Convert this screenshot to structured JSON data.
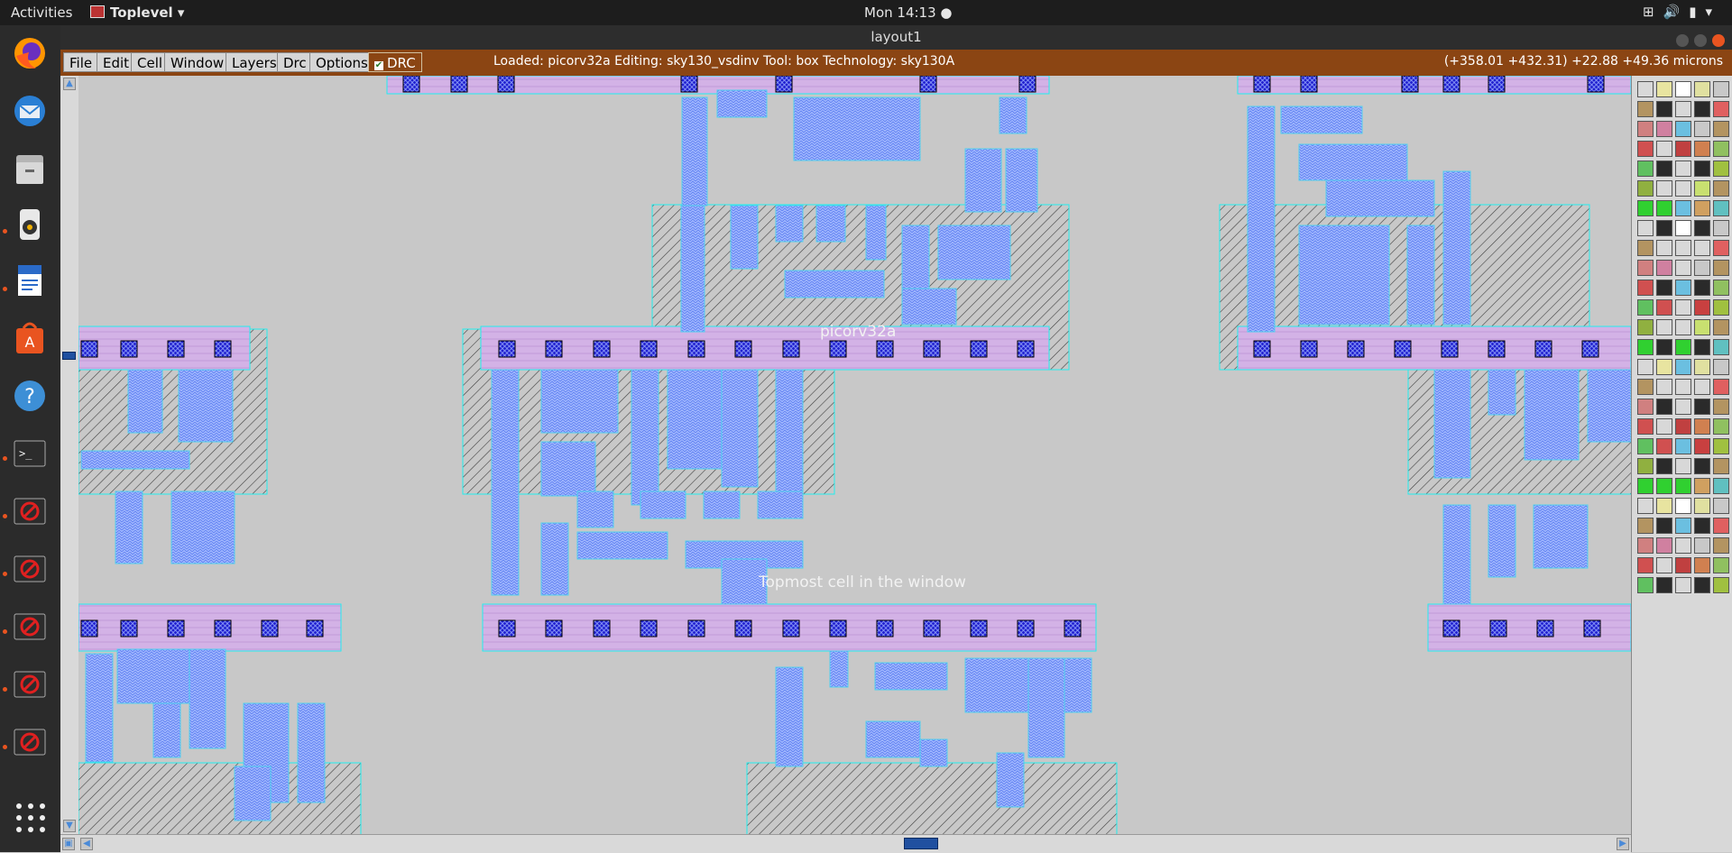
{
  "topbar": {
    "activities": "Activities",
    "app_menu": "Toplevel",
    "clock": "Mon 14:13 ●"
  },
  "window": {
    "title": "layout1"
  },
  "menubar": {
    "items": [
      "File",
      "Edit",
      "Cell",
      "Window",
      "Layers",
      "Drc",
      "Options"
    ],
    "drc_label": "DRC",
    "drc_checked": true,
    "status": "Loaded: picorv32a Editing: sky130_vsdinv Tool: box  Technology: sky130A",
    "coords": "(+358.01 +432.31) +22.88 +49.36 microns"
  },
  "canvas": {
    "cell_label": "picorv32a",
    "topmost_label": "Topmost cell in the window"
  },
  "dock": {
    "apps": [
      "firefox-icon",
      "thunderbird-icon",
      "files-icon",
      "rhythmbox-icon",
      "writer-icon",
      "software-icon",
      "help-icon",
      "terminal-icon",
      "blocked-icon",
      "blocked-icon",
      "blocked-icon",
      "blocked-icon",
      "blocked-icon"
    ]
  },
  "colors": {
    "menubar": "#8b4513",
    "canvas": "#c8c8c8",
    "metal": "#8ea8ff",
    "poly_contact": "#1a1acc",
    "rail": "#d6a8e8",
    "ndiff": "#303030"
  }
}
